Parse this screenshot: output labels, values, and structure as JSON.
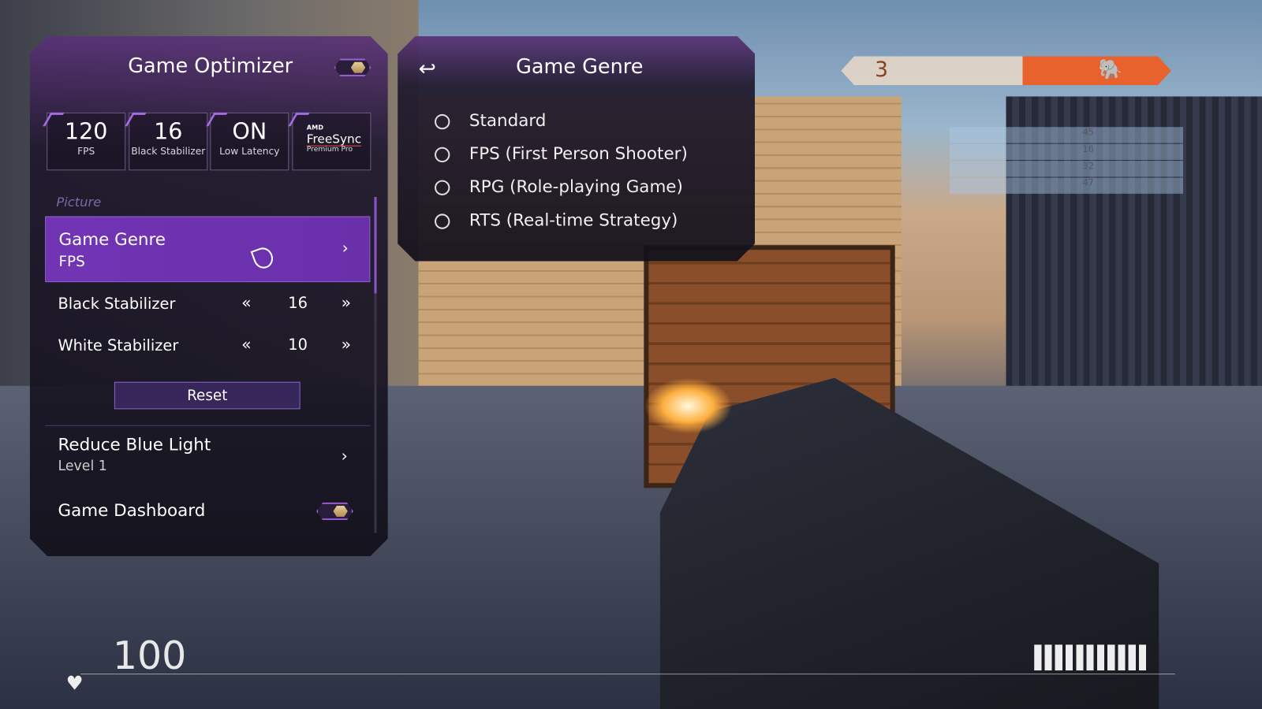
{
  "optimizer": {
    "title": "Game Optimizer",
    "toggle_on": true,
    "tiles": [
      {
        "value": "120",
        "label": "FPS"
      },
      {
        "value": "16",
        "label": "Black Stabilizer"
      },
      {
        "value": "ON",
        "label": "Low Latency"
      },
      {
        "brand_top": "AMD",
        "brand": "FreeSync",
        "brand_sub": "Premium Pro"
      }
    ],
    "section_label": "Picture",
    "game_genre": {
      "label": "Game Genre",
      "value": "FPS"
    },
    "black_stabilizer": {
      "label": "Black Stabilizer",
      "value": "16"
    },
    "white_stabilizer": {
      "label": "White Stabilizer",
      "value": "10"
    },
    "reset_label": "Reset",
    "reduce_blue_light": {
      "label": "Reduce Blue Light",
      "value": "Level 1"
    },
    "game_dashboard": {
      "label": "Game Dashboard",
      "toggle_on": true
    }
  },
  "genre_panel": {
    "title": "Game Genre",
    "options": [
      "Standard",
      "FPS (First Person Shooter)",
      "RPG (Role-playing Game)",
      "RTS (Real-time Strategy)"
    ]
  },
  "hud": {
    "health": "100",
    "team_score": "3",
    "scoreboard": [
      "45",
      "16",
      "32",
      "47"
    ]
  },
  "colors": {
    "accent": "#7b3fbf",
    "highlight": "#6e34ad",
    "hud_orange": "#e8622e"
  }
}
